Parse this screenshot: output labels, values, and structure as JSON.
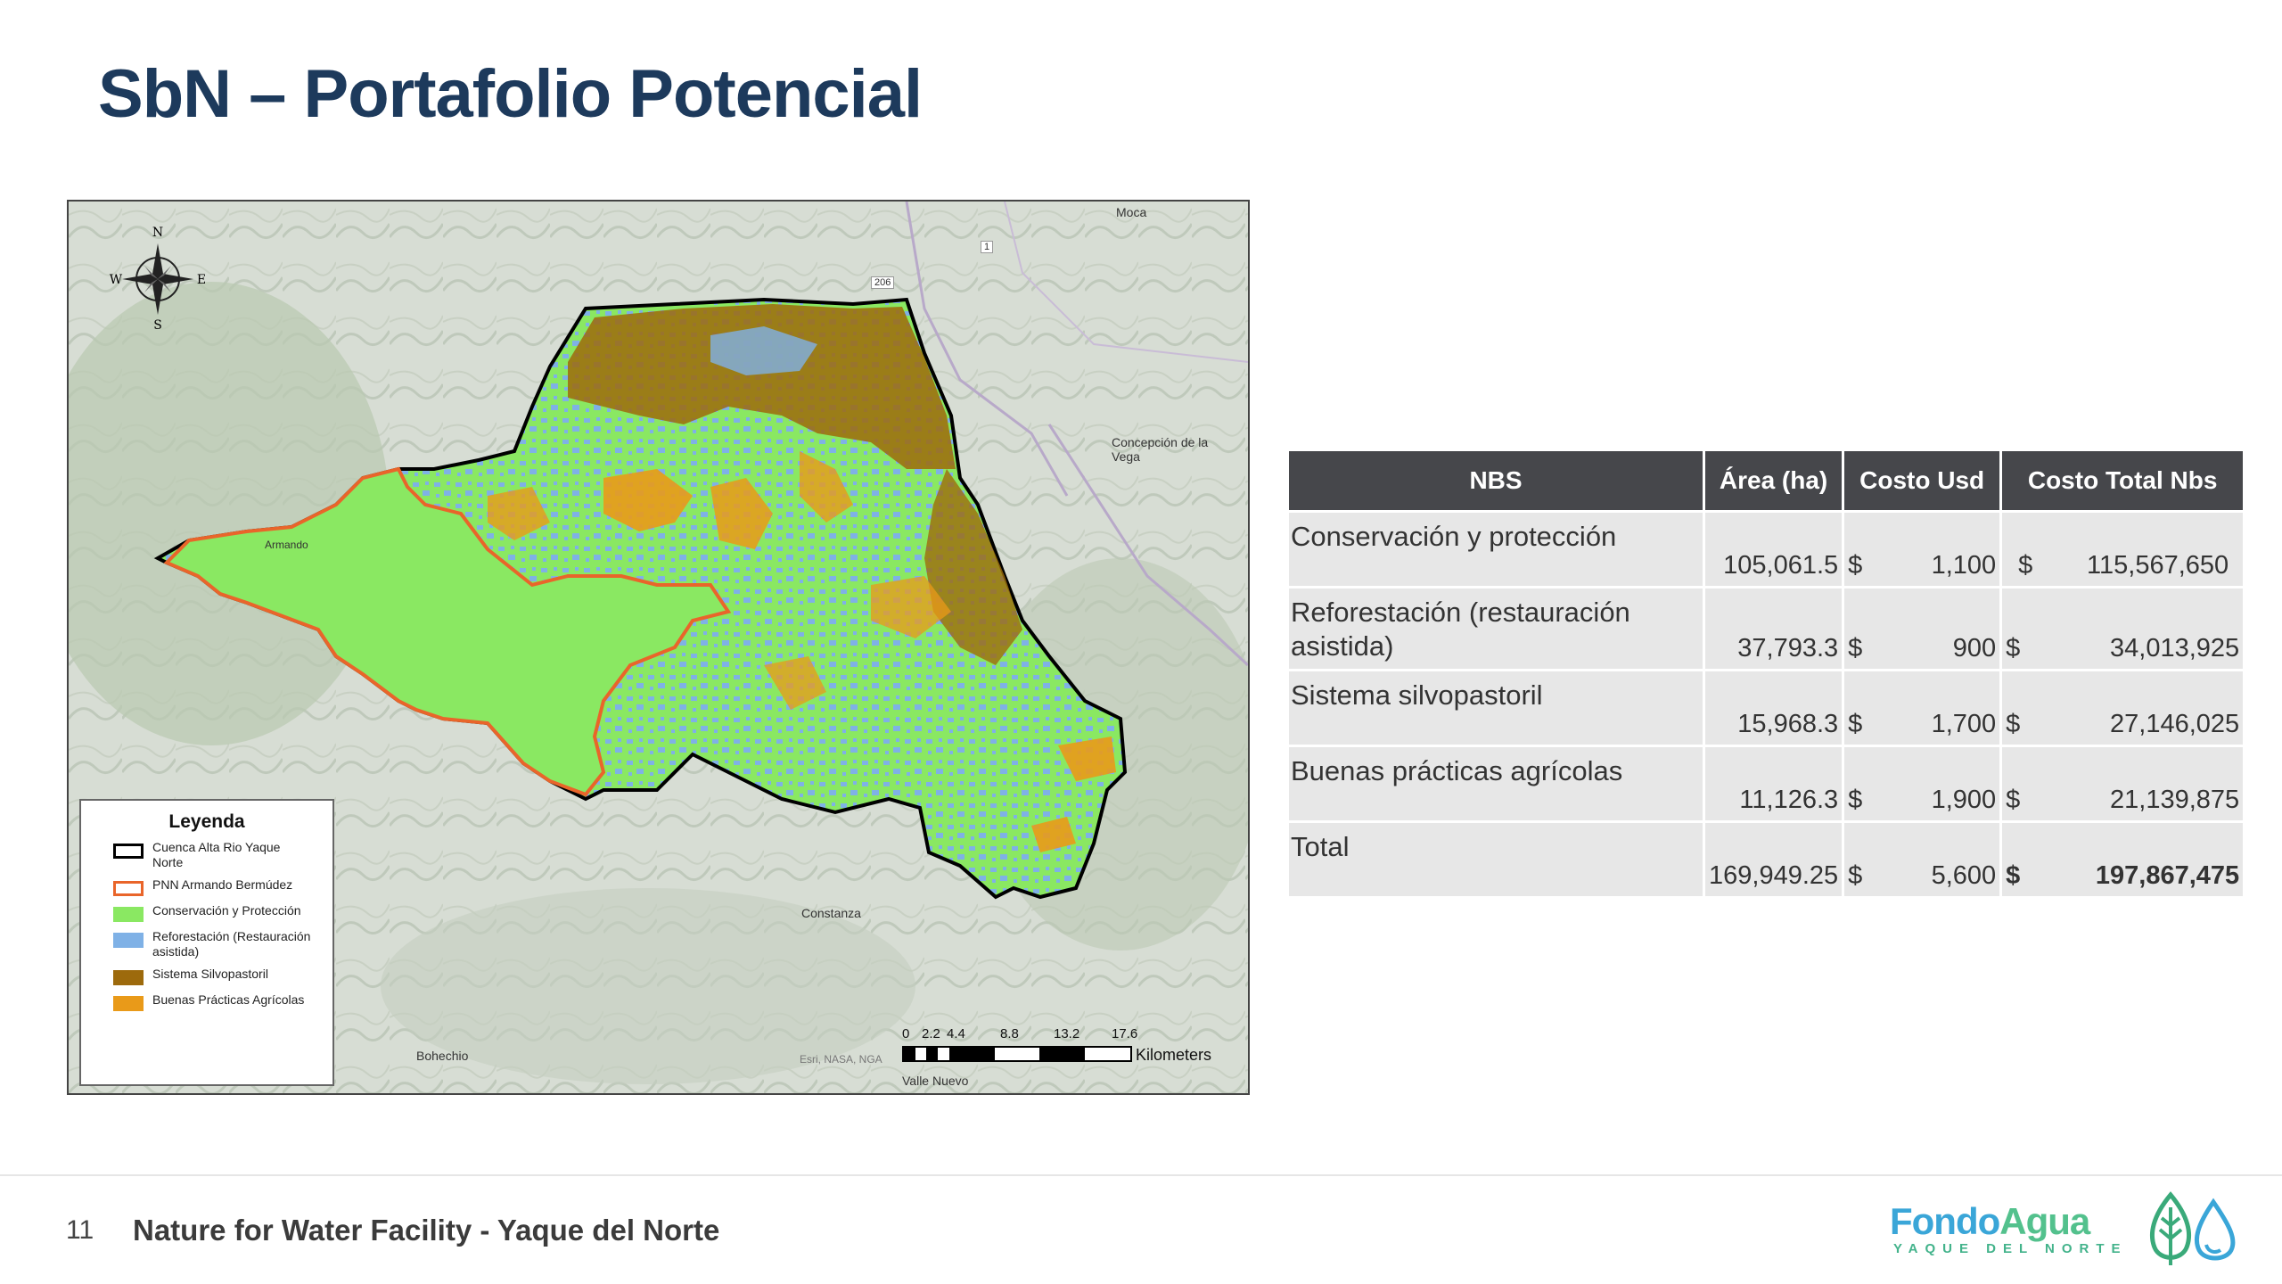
{
  "slide": {
    "title": "SbN – Portafolio Potencial",
    "page_number": "11",
    "footer": "Nature for Water Facility  - Yaque del Norte"
  },
  "map": {
    "compass": {
      "n": "N",
      "s": "S",
      "e": "E",
      "w": "W"
    },
    "legend": {
      "title": "Leyenda",
      "items": [
        {
          "label": "Cuenca Alta Rio Yaque Norte",
          "color": "#000000",
          "style": "outline"
        },
        {
          "label": "PNN Armando Bermúdez",
          "color": "#e9652a",
          "style": "outline"
        },
        {
          "label": "Conservación y Protección",
          "color": "#8ae862",
          "style": "fill"
        },
        {
          "label": "Reforestación (Restauración asistida)",
          "color": "#7fb1e6",
          "style": "fill"
        },
        {
          "label": "Sistema Silvopastoril",
          "color": "#9d6a0c",
          "style": "fill"
        },
        {
          "label": "Buenas Prácticas Agrícolas",
          "color": "#e99a19",
          "style": "fill"
        }
      ]
    },
    "places": {
      "moca": "Moca",
      "concepcion": "Concepción de la Vega",
      "constanza": "Constanza",
      "bohechio": "Bohechio",
      "valle_nuevo": "Valle Nuevo",
      "armando": "Armando",
      "route_206": "206",
      "route_1": "1",
      "attribution": "Esri, NASA, NGA"
    },
    "scale": {
      "ticks": [
        "0",
        "2.2",
        "4.4",
        "8.8",
        "13.2",
        "17.6"
      ],
      "unit": "Kilometers"
    }
  },
  "table": {
    "headers": [
      "NBS",
      "Área (ha)",
      "Costo Usd",
      "Costo Total Nbs"
    ],
    "currency": "$",
    "rows": [
      {
        "nbs": "Conservación y protección",
        "area": "105,061.5",
        "cost": "1,100",
        "total": "115,567,650"
      },
      {
        "nbs": "Reforestación (restauración asistida)",
        "area": "37,793.3",
        "cost": "900",
        "total": "34,013,925"
      },
      {
        "nbs": "Sistema silvopastoril",
        "area": "15,968.3",
        "cost": "1,700",
        "total": "27,146,025"
      },
      {
        "nbs": "Buenas prácticas agrícolas",
        "area": "11,126.3",
        "cost": "1,900",
        "total": "21,139,875"
      }
    ],
    "total": {
      "nbs": "Total",
      "area": "169,949.25",
      "cost": "5,600",
      "total": "197,867,475"
    }
  },
  "logo": {
    "name_part1": "Fondo",
    "name_part2": "Agua",
    "subtitle": "YAQUE DEL NORTE"
  }
}
